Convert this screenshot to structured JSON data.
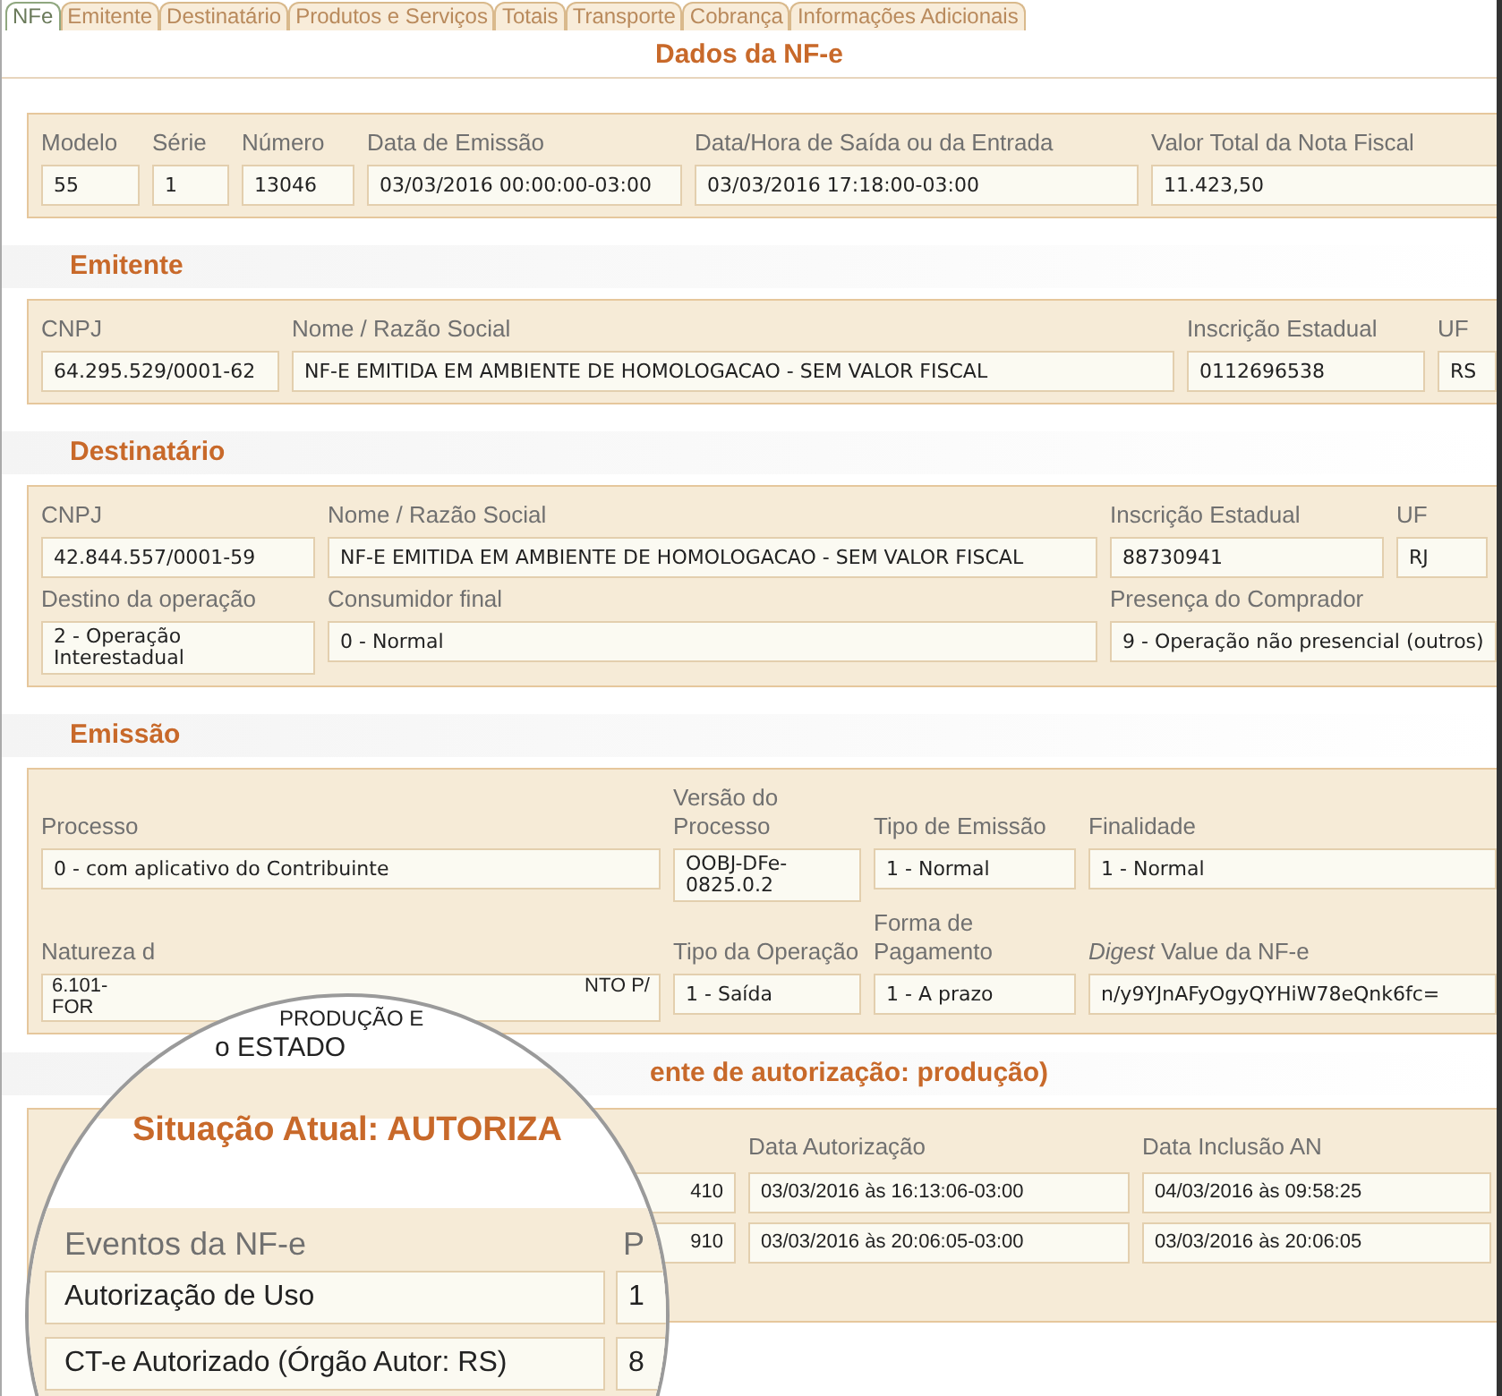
{
  "tabs": [
    {
      "label": "NFe",
      "selected": true
    },
    {
      "label": "Emitente",
      "selected": false
    },
    {
      "label": "Destinatário",
      "selected": false
    },
    {
      "label": "Produtos e Serviços",
      "selected": false
    },
    {
      "label": "Totais",
      "selected": false
    },
    {
      "label": "Transporte",
      "selected": false
    },
    {
      "label": "Cobrança",
      "selected": false
    },
    {
      "label": "Informações Adicionais",
      "selected": false
    }
  ],
  "title": "Dados da NF-e",
  "sections": [
    {
      "rows": [
        {
          "fields": [
            {
              "kind": "text",
              "label": "Modelo",
              "value": "55"
            },
            {
              "kind": "text",
              "label": "Série",
              "value": "1"
            },
            {
              "kind": "text",
              "label": "Número",
              "value": "13046"
            },
            {
              "kind": "text",
              "label": "Data de Emissão",
              "value": "03/03/2016 00:00:00-03:00"
            },
            {
              "kind": "text",
              "label": "Data/Hora de Saída ou da Entrada",
              "value": "03/03/2016 17:18:00-03:00"
            },
            {
              "kind": "text",
              "label": "Valor Total da Nota Fiscal",
              "value": "11.423,50"
            }
          ]
        }
      ]
    },
    {
      "heading": "Emitente",
      "rows": [
        {
          "fields": [
            {
              "kind": "text",
              "label": "CNPJ",
              "value": "64.295.529/0001-62"
            },
            {
              "kind": "text",
              "label": "Nome / Razão Social",
              "value": "NF-E EMITIDA EM AMBIENTE DE HOMOLOGACAO - SEM VALOR FISCAL"
            },
            {
              "kind": "text",
              "label": "Inscrição Estadual",
              "value": "0112696538"
            },
            {
              "kind": "text",
              "label": "UF",
              "value": "RS"
            }
          ]
        }
      ]
    },
    {
      "heading": "Destinatário",
      "rows": [
        {
          "fields": [
            {
              "kind": "text",
              "label": "CNPJ",
              "value": "42.844.557/0001-59"
            },
            {
              "kind": "text",
              "label": "Nome / Razão Social",
              "value": "NF-E EMITIDA EM AMBIENTE DE HOMOLOGACAO - SEM VALOR FISCAL"
            },
            {
              "kind": "text",
              "label": "Inscrição Estadual",
              "value": "88730941"
            },
            {
              "kind": "text",
              "label": "UF",
              "value": "RJ"
            }
          ]
        },
        {
          "fields": [
            {
              "kind": "text",
              "label": "Destino da operação",
              "value": "2 - Operação Interestadual"
            },
            {
              "kind": "text",
              "label": "Consumidor final",
              "value": "0 - Normal"
            },
            {
              "kind": "text",
              "label": "Presença do Comprador",
              "value": "9 - Operação não presencial (outros)"
            }
          ]
        }
      ]
    },
    {
      "heading": "Emissão",
      "rows": [
        {
          "fields": [
            {
              "kind": "text",
              "label": "Processo",
              "value": "0 - com aplicativo do Contribuinte"
            },
            {
              "kind": "text",
              "label": "Versão do Processo",
              "value": "OOBJ-DFe-0825.0.2"
            },
            {
              "kind": "text",
              "label": "Tipo de Emissão",
              "value": "1 - Normal"
            },
            {
              "kind": "text",
              "label": "Finalidade",
              "value": "1 - Normal"
            }
          ]
        },
        {
          "fields": [
            {
              "kind": "partial",
              "label": "Natureza d",
              "value_lines": [
                "6.101-",
                "FOR"
              ],
              "value_right": "NTO P/"
            },
            {
              "kind": "text",
              "label": "Tipo da Operação",
              "value": "1 - Saída"
            },
            {
              "kind": "text",
              "label": "Forma de Pagamento",
              "value": "1 - A prazo"
            },
            {
              "kind": "text",
              "label": "*Digest* Value da NF-e",
              "value": "n/y9YJnAFyOgyQYHiW78eQnk6fc="
            }
          ]
        }
      ]
    }
  ],
  "status_visible": "ente de autorização: produção)",
  "events": {
    "columns": [
      "Data Autorização",
      "Data Inclusão AN"
    ],
    "rows": [
      {
        "protocol": "410",
        "authorized": "03/03/2016 às 16:13:06-03:00",
        "included": "04/03/2016 às 09:58:25"
      },
      {
        "protocol": "910",
        "authorized": "03/03/2016 às 20:06:05-03:00",
        "included": "03/03/2016 às 20:06:05"
      }
    ]
  },
  "magnifier": {
    "top_texts": [
      "PRODUÇÃO E",
      "o ESTADO"
    ],
    "status": "Situação Atual: AUTORIZA",
    "events_header": "Eventos da NF-e",
    "protocol_header": "P",
    "rows": [
      {
        "event": "Autorização de Uso",
        "protocol": "1"
      },
      {
        "event": "CT-e Autorizado (Órgão Autor: RS)",
        "protocol": "8"
      }
    ]
  }
}
